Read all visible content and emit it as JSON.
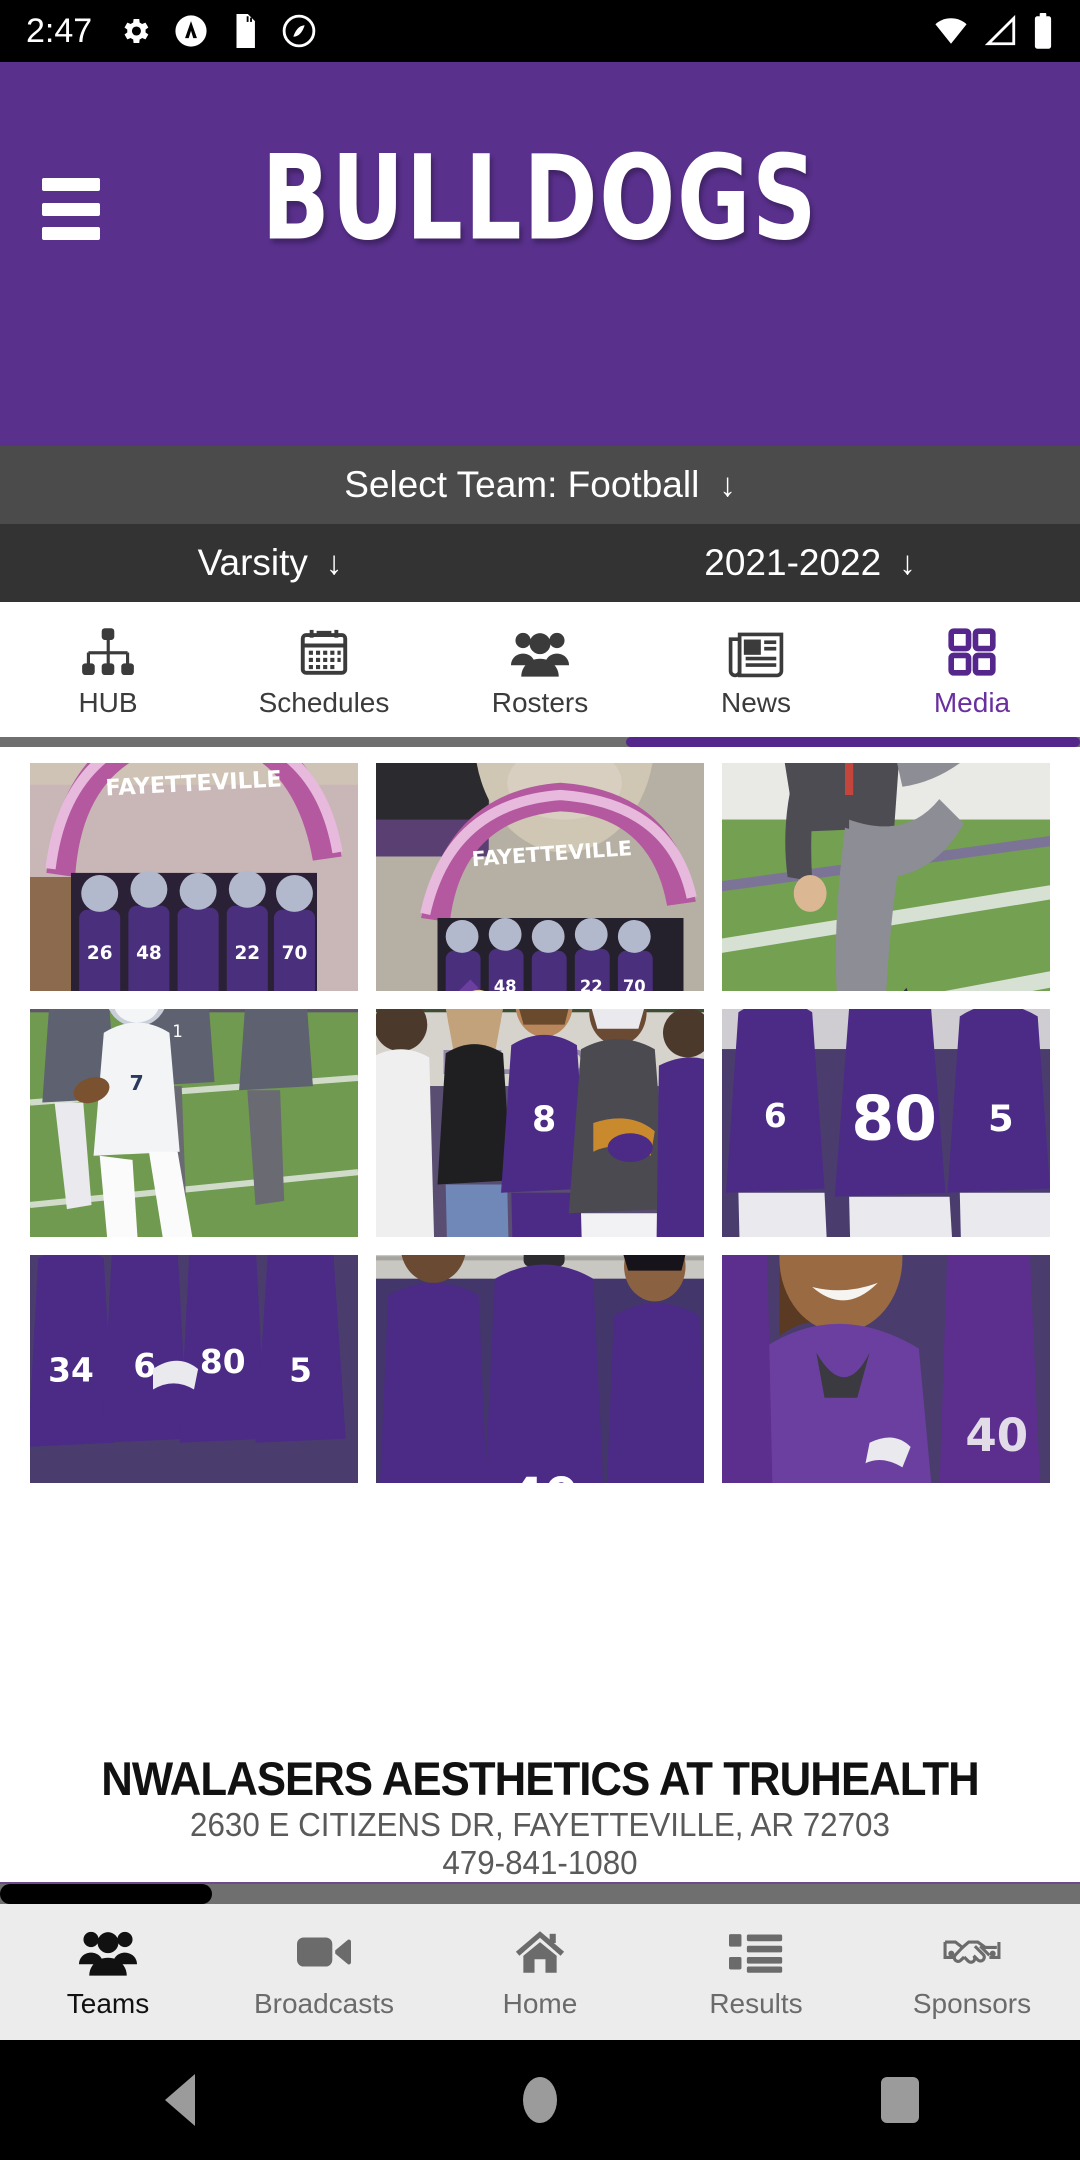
{
  "status_bar": {
    "time": "2:47",
    "left_icons": [
      "gear-icon",
      "app-badge-icon",
      "sd-card-icon",
      "no-circle-icon"
    ],
    "right_icons": [
      "wifi-icon",
      "signal-icon",
      "battery-icon"
    ]
  },
  "header": {
    "menu_icon": "hamburger-menu-icon",
    "title": "BULLDOGS",
    "background_color": "#59308c"
  },
  "team_selector": {
    "label": "Select Team:",
    "team": "Football",
    "full_text": "Select Team:  Football",
    "arrow": "↓",
    "background_color": "#4b4b4b"
  },
  "sub_selector": {
    "level": "Varsity",
    "season": "2021-2022",
    "arrow": "↓",
    "background_color": "#333333"
  },
  "tabs": {
    "active_index": 4,
    "accent_color": "#55268b",
    "items": [
      {
        "label": "HUB",
        "icon": "sitemap-hierarchy-icon"
      },
      {
        "label": "Schedules",
        "icon": "calendar-icon"
      },
      {
        "label": "Rosters",
        "icon": "people-group-icon"
      },
      {
        "label": "News",
        "icon": "newspaper-icon"
      },
      {
        "label": "Media",
        "icon": "grid-squares-icon"
      }
    ]
  },
  "media_grid": {
    "rows": 3,
    "columns": 3,
    "items": [
      {
        "caption": "Team running out under Fayetteville Bulldogs inflatable arch"
      },
      {
        "caption": "Cheerleader with smoke in front of Fayetteville Bulldogs arch"
      },
      {
        "caption": "Coach in grey polo kicking a football on the field"
      },
      {
        "caption": "Running back in white jersey carrying the ball"
      },
      {
        "caption": "Students and players posing on the sideline"
      },
      {
        "caption": "Three players in purple jerseys numbers 80 and 5"
      },
      {
        "caption": "Four players in purple jerseys 34, 6, 80, 5 on sideline"
      },
      {
        "caption": "Players in purple jerseys with headbands on the sideline"
      },
      {
        "caption": "Smiling player in purple jersey close up"
      }
    ]
  },
  "sponsor": {
    "name": "NWALASERS AESTHETICS AT TRUHEALTH",
    "address": "2630 E CITIZENS DR, FAYETTEVILLE, AR 72703",
    "phone": "479-841-1080"
  },
  "bottom_nav": {
    "active_index": 0,
    "items": [
      {
        "label": "Teams",
        "icon": "people-group-icon"
      },
      {
        "label": "Broadcasts",
        "icon": "video-camera-icon"
      },
      {
        "label": "Home",
        "icon": "house-icon"
      },
      {
        "label": "Results",
        "icon": "list-icon"
      },
      {
        "label": "Sponsors",
        "icon": "handshake-icon"
      }
    ]
  },
  "android_nav": {
    "back": "back-triangle-icon",
    "home": "home-circle-icon",
    "recents": "recents-square-icon"
  }
}
